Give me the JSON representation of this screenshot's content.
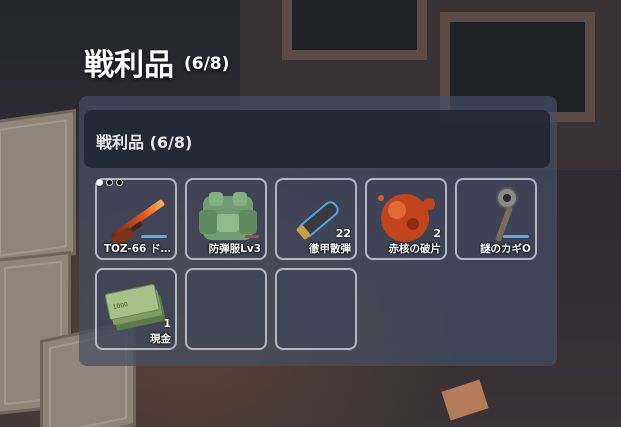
{
  "header_title": "戦利品",
  "header_count": "(6/8)",
  "panel_title": "戦利品 (6/8)",
  "items": [
    {
      "name": "TOZ-66 ド…",
      "qty": "",
      "icon": "shotgun-icon"
    },
    {
      "name": "防弾服Lv3",
      "qty": "",
      "icon": "body-armor-icon"
    },
    {
      "name": "徹甲散弾",
      "qty": "22",
      "icon": "shell-ammo-icon"
    },
    {
      "name": "赤核の破片",
      "qty": "2",
      "icon": "red-core-icon"
    },
    {
      "name": "謎のカギO",
      "qty": "",
      "icon": "key-icon"
    },
    {
      "name": "現金",
      "qty": "1",
      "icon": "cash-icon"
    }
  ],
  "empty_slots": 2,
  "colors": {
    "accent_bar": "#58a9e6",
    "panel": "#464e62",
    "slot_border": "#e6e8f0"
  }
}
